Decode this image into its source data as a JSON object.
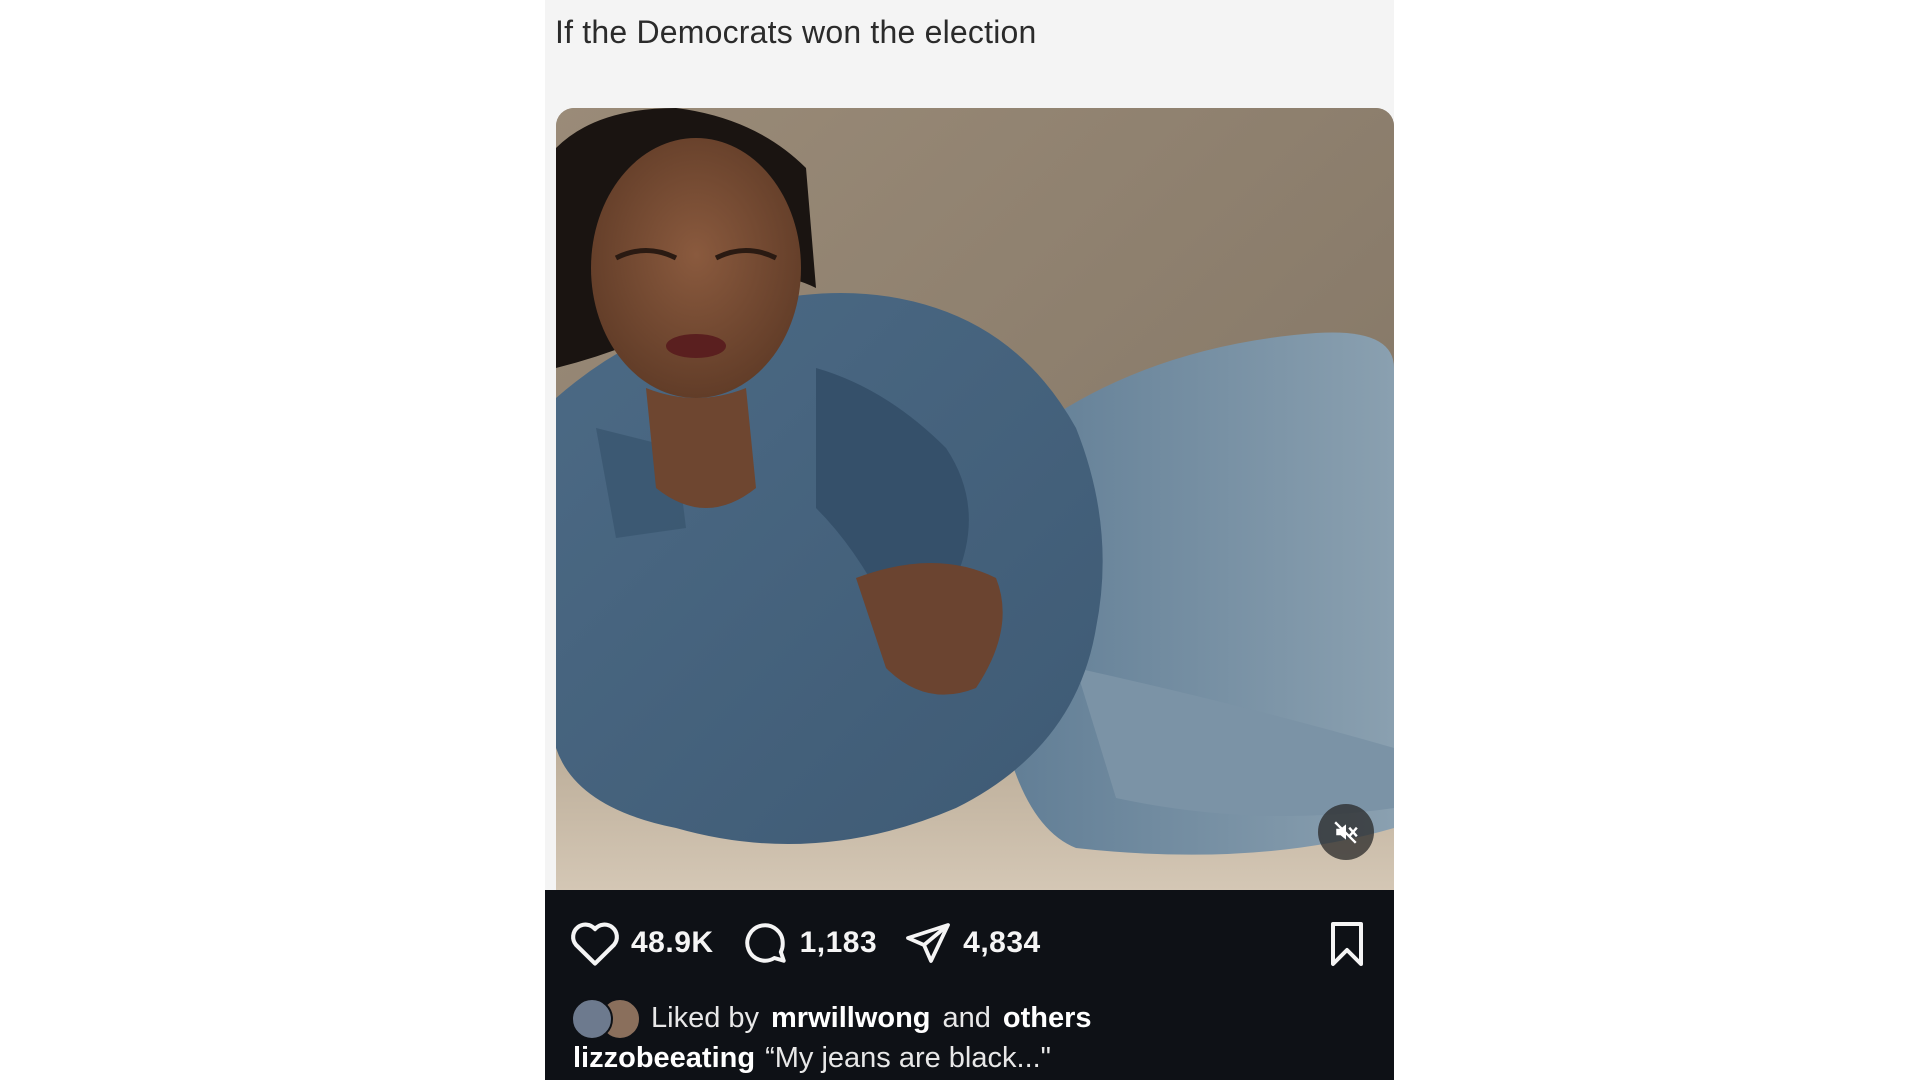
{
  "post": {
    "header_text": "If the Democrats won the election",
    "media": {
      "description_icon": "video-photo",
      "mute_icon": "muted-speaker-icon"
    },
    "actions": {
      "likes": "48.9K",
      "comments": "1,183",
      "shares": "4,834"
    },
    "liked_by": {
      "prefix": "Liked by",
      "user": "mrwillwong",
      "connector": "and",
      "suffix": "others"
    },
    "caption": {
      "username": "lizzobeeating",
      "text": "“My jeans are black...\""
    }
  },
  "colors": {
    "bar_background": "#0e1116",
    "page_background": "#f4f4f4",
    "text_light": "#f5f5f5"
  }
}
